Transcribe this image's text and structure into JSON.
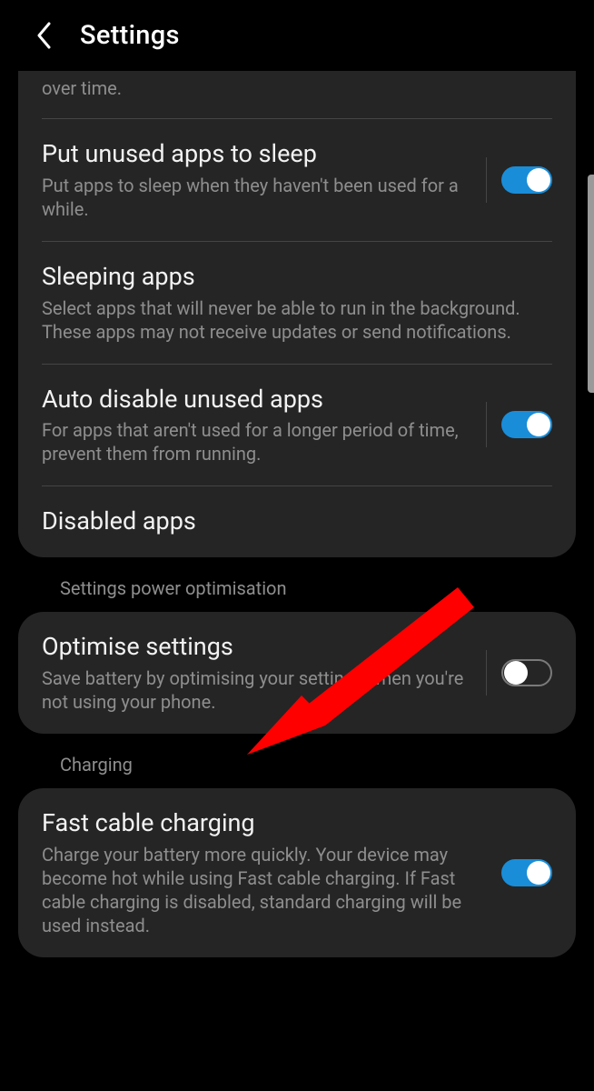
{
  "header": {
    "title": "Settings"
  },
  "partial_row": {
    "subtitle_fragment": "over time."
  },
  "group1": {
    "items": [
      {
        "title": "Put unused apps to sleep",
        "subtitle": "Put apps to sleep when they haven't been used for a while.",
        "toggle": "on"
      },
      {
        "title": "Sleeping apps",
        "subtitle": "Select apps that will never be able to run in the background. These apps may not receive updates or send notifications."
      },
      {
        "title": "Auto disable unused apps",
        "subtitle": "For apps that aren't used for a longer period of time, prevent them from running.",
        "toggle": "on"
      },
      {
        "title": "Disabled apps"
      }
    ]
  },
  "section2": {
    "heading": "Settings power optimisation",
    "item": {
      "title": "Optimise settings",
      "subtitle": "Save battery by optimising your settings when you're not using your phone.",
      "toggle": "off"
    }
  },
  "section3": {
    "heading": "Charging",
    "item": {
      "title": "Fast cable charging",
      "subtitle": "Charge your battery more quickly. Your device may become hot while using Fast cable charging. If Fast cable charging is disabled, standard charging will be used instead.",
      "toggle": "on"
    }
  }
}
